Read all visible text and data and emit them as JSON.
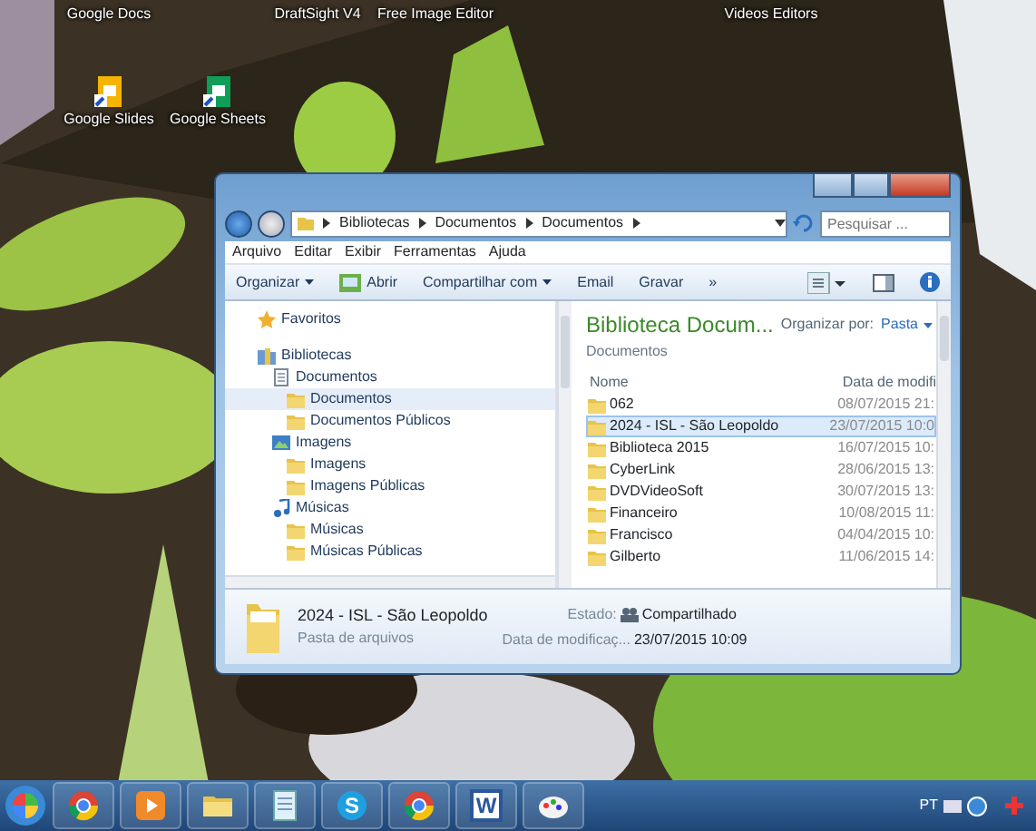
{
  "desktop_icons": [
    {
      "label": "Google Docs",
      "kind": "label_only"
    },
    {
      "label": "DraftSight V4",
      "kind": "label_only"
    },
    {
      "label": "Free Image Editor",
      "kind": "label_only"
    },
    {
      "label": "Videos Editors",
      "kind": "label_only"
    },
    {
      "label": "Google Slides",
      "kind": "slides"
    },
    {
      "label": "Google Sheets",
      "kind": "sheets"
    }
  ],
  "window": {
    "breadcrumb": [
      "Bibliotecas",
      "Documentos",
      "Documentos"
    ],
    "search": {
      "placeholder": "Pesquisar ..."
    },
    "menu": [
      "Arquivo",
      "Editar",
      "Exibir",
      "Ferramentas",
      "Ajuda"
    ],
    "toolbar": [
      {
        "label": "Organizar",
        "dropdown": true,
        "kind": "text"
      },
      {
        "label": "Abrir",
        "dropdown": false,
        "kind": "open"
      },
      {
        "label": "Compartilhar com",
        "dropdown": true,
        "kind": "text"
      },
      {
        "label": "Email",
        "dropdown": false,
        "kind": "text"
      },
      {
        "label": "Gravar",
        "dropdown": false,
        "kind": "text"
      },
      {
        "label": "»",
        "dropdown": false,
        "kind": "text"
      }
    ],
    "nav": [
      {
        "label": "Favoritos",
        "kind": "favorites",
        "selected": false
      },
      {
        "label": "Bibliotecas",
        "kind": "library",
        "selected": false,
        "children": [
          {
            "label": "Documentos",
            "kind": "document",
            "selected": false,
            "children": [
              {
                "label": "Documentos",
                "kind": "folder",
                "selected": true
              },
              {
                "label": "Documentos Públicos",
                "kind": "folder",
                "selected": false
              }
            ]
          },
          {
            "label": "Imagens",
            "kind": "images",
            "selected": false,
            "children": [
              {
                "label": "Imagens",
                "kind": "folder",
                "selected": false
              },
              {
                "label": "Imagens Públicas",
                "kind": "folder",
                "selected": false
              }
            ]
          },
          {
            "label": "Músicas",
            "kind": "music",
            "selected": false,
            "children": [
              {
                "label": "Músicas",
                "kind": "folder",
                "selected": false
              },
              {
                "label": "Músicas Públicas",
                "kind": "folder",
                "selected": false
              }
            ]
          }
        ]
      }
    ],
    "library": {
      "title": "Biblioteca Docum...",
      "subtitle": "Documentos",
      "arrange_label": "Organizar por:",
      "arrange_value": "Pasta"
    },
    "columns": [
      "Nome",
      "Data de modifi"
    ],
    "rows": [
      {
        "name": "062",
        "date": "08/07/2015 21:",
        "selected": false
      },
      {
        "name": "2024 - ISL - São Leopoldo",
        "date": "23/07/2015 10:0",
        "selected": true
      },
      {
        "name": "Biblioteca 2015",
        "date": "16/07/2015 10:",
        "selected": false
      },
      {
        "name": "CyberLink",
        "date": "28/06/2015 13:",
        "selected": false
      },
      {
        "name": "DVDVideoSoft",
        "date": "30/07/2015 13:",
        "selected": false
      },
      {
        "name": "Financeiro",
        "date": "10/08/2015 11:",
        "selected": false
      },
      {
        "name": "Francisco",
        "date": "04/04/2015 10:",
        "selected": false
      },
      {
        "name": "Gilberto",
        "date": "11/06/2015 14:",
        "selected": false
      }
    ],
    "details": {
      "name": "2024 - ISL - São Leopoldo",
      "type": "Pasta de arquivos",
      "status_label": "Estado:",
      "status": "Compartilhado",
      "date_label": "Data de modificaç...",
      "date": "23/07/2015 10:09"
    }
  },
  "taskbar": {
    "items": [
      {
        "kind": "chrome"
      },
      {
        "kind": "media"
      },
      {
        "kind": "folder"
      },
      {
        "kind": "document"
      },
      {
        "kind": "skype",
        "glyph": "S"
      },
      {
        "kind": "chrome"
      },
      {
        "kind": "word",
        "glyph": "W"
      },
      {
        "kind": "paint"
      }
    ],
    "language": "PT"
  }
}
